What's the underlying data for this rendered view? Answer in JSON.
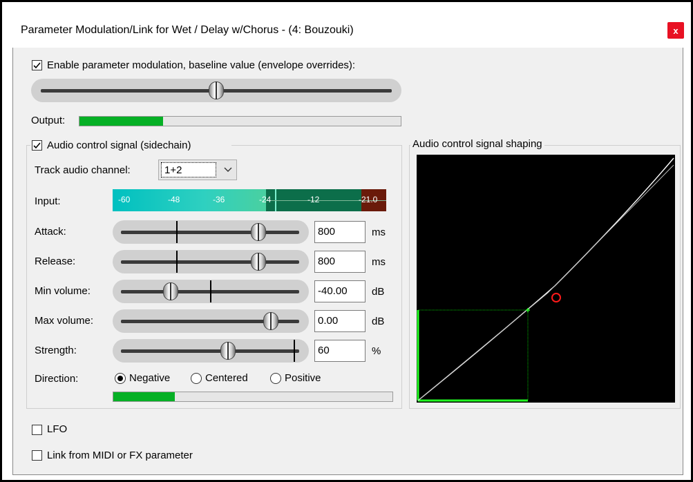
{
  "dialog": {
    "title": "Parameter Modulation/Link for Wet / Delay w/Chorus - (4: Bouzouki)",
    "close_glyph": "x"
  },
  "modulation": {
    "enable_label": "Enable parameter modulation, baseline value (envelope overrides):",
    "enable_checked": true,
    "baseline_value": 0.5,
    "output_label": "Output:",
    "output_level": 0.26
  },
  "audio_control": {
    "group_label": "Audio control signal (sidechain)",
    "checked": true,
    "track_channel_label": "Track audio channel:",
    "track_channel_value": "1+2",
    "input_label": "Input:",
    "input_scale": [
      "-60",
      "-48",
      "-36",
      "-24",
      "-12",
      "-21.0"
    ],
    "params": [
      {
        "label": "Attack:",
        "value": "800",
        "unit": "ms",
        "level": 0.77
      },
      {
        "label": "Release:",
        "value": "800",
        "unit": "ms",
        "level": 0.77
      },
      {
        "label": "Min volume:",
        "value": "-40.00",
        "unit": "dB",
        "level": 0.28
      },
      {
        "label": "Max volume:",
        "value": "0.00",
        "unit": "dB",
        "level": 0.84
      },
      {
        "label": "Strength:",
        "value": "60",
        "unit": "%",
        "level": 0.6
      }
    ],
    "direction_label": "Direction:",
    "direction_options": [
      "Negative",
      "Centered",
      "Positive"
    ],
    "direction_selected": "Negative",
    "direction_level": 0.22
  },
  "shaping": {
    "group_label": "Audio control signal shaping"
  },
  "lfo": {
    "label": "LFO",
    "checked": false
  },
  "link": {
    "label": "Link from MIDI or FX parameter",
    "checked": false
  },
  "colors": {
    "accent_green": "#06b025",
    "graph_bg": "#000000",
    "curve": "#ffffff",
    "marker": "#ff1a1a",
    "input_meter": "#1fc4bf"
  },
  "icons": [
    "check-icon",
    "close-icon",
    "chevron-down-icon"
  ]
}
